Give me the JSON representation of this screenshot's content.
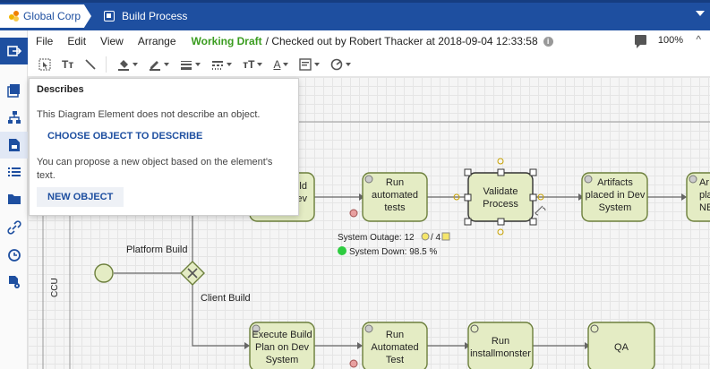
{
  "tabs": {
    "org_label": "Global Corp",
    "process_label": "Build Process"
  },
  "menubar": {
    "items": [
      "File",
      "Edit",
      "View",
      "Arrange"
    ],
    "status_draft": "Working Draft",
    "status_rest": "/ Checked out by Robert Thacker at 2018-09-04 12:33:58",
    "info_icon": "i",
    "zoom": "100%",
    "zoom_collapse": "^"
  },
  "toolbar": {
    "text_tool": "Tт",
    "font_size_tool": "тТ",
    "font_color_tool": "A"
  },
  "popup": {
    "title": "Describes",
    "message": "This Diagram Element does not describe an object.",
    "choose_button": "CHOOSE OBJECT TO DESCRIBE",
    "propose_message": "You can propose a new object based on the element's text.",
    "new_button": "NEW OBJECT"
  },
  "diagram": {
    "lane_label": "CCU",
    "gateway_upper_label": "Platform Build",
    "gateway_lower_label": "Client Build",
    "tasks_row1": [
      {
        "line1": "...uild",
        "line2": "...Dev"
      },
      {
        "line1": "Run",
        "line2": "automated",
        "line3": "tests"
      },
      {
        "line1": "Validate",
        "line2": "Process"
      },
      {
        "line1": "Artifacts",
        "line2": "placed in Dev",
        "line3": "System"
      },
      {
        "line1": "Ar",
        "line2": "pla",
        "line3": "NE"
      }
    ],
    "tasks_row2": [
      {
        "line1": "Execute Build",
        "line2": "Plan on Dev",
        "line3": "System"
      },
      {
        "line1": "Run",
        "line2": "Automated",
        "line3": "Test"
      },
      {
        "line1": "Run",
        "line2": "installmonster"
      },
      {
        "line1": "QA"
      }
    ],
    "kpi_outage": "System Outage: 12",
    "kpi_outage_suffix": "/ 4",
    "kpi_down": "System Down: 98.5 %",
    "colors": {
      "task_fill": "#e4ecc4",
      "task_stroke": "#6c7f3c",
      "kpi_green": "#2ecc40",
      "kpi_yellow": "#f5e66b"
    }
  }
}
